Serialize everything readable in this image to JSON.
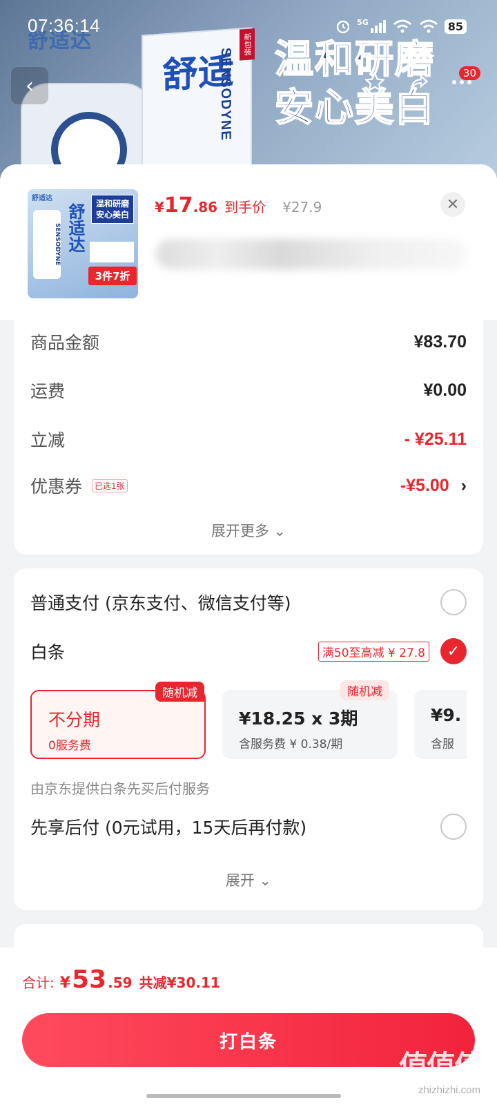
{
  "status_bar": {
    "time": "07:36:14",
    "network": "5G",
    "battery": "85"
  },
  "hero": {
    "logo_text": "舒适达",
    "brand_vertical": "SENSODYNE",
    "box_chars": "舒适",
    "box_tag": "新包装",
    "slogan_line1": "温和研磨",
    "slogan_line2": "安心美白",
    "cart_badge": "30"
  },
  "product": {
    "thumb_logo": "舒适达",
    "thumb_slogan": "温和研磨安心美白",
    "thumb_brand": "SENSODYNE",
    "thumb_chars": "舒适达",
    "thumb_promo": "3件7折",
    "price_symbol": "¥",
    "price_int": "17",
    "price_dec": ".86",
    "price_label": "到手价",
    "original_price": "¥27.9"
  },
  "amounts": {
    "goods_label": "商品金额",
    "goods_value": "¥83.70",
    "shipping_label": "运费",
    "shipping_value": "¥0.00",
    "discount_label": "立减",
    "discount_value": "- ¥25.11",
    "coupon_label": "优惠券",
    "coupon_tag": "已选1张",
    "coupon_value": "-¥5.00",
    "expand_more": "展开更多"
  },
  "payment": {
    "normal_label": "普通支付 (京东支付、微信支付等)",
    "baitiao_label": "白条",
    "baitiao_promo": "满50至高减 ¥ 27.8",
    "installments": [
      {
        "title": "不分期",
        "sub": "0服务费",
        "tag": "随机减"
      },
      {
        "title": "¥18.25 x 3期",
        "sub": "含服务费 ¥ 0.38/期",
        "tag": "随机减"
      },
      {
        "title": "¥9.",
        "sub": "含服"
      }
    ],
    "provider_note": "由京东提供白条先买后付服务",
    "bnpl_label": "先享后付 (0元试用，15天后再付款)",
    "expand": "展开"
  },
  "footer": {
    "total_label": "合计:",
    "total_symbol": "¥",
    "total_int": "53",
    "total_dec": ".59",
    "total_saved": "共减¥30.11",
    "cta": "打白条",
    "watermark": "值值值",
    "watermark_url": "zhizhizhi.com"
  },
  "colors": {
    "accent_red": "#e8262d",
    "cta_gradient_start": "#ff4a5d",
    "cta_gradient_end": "#f2233b"
  }
}
